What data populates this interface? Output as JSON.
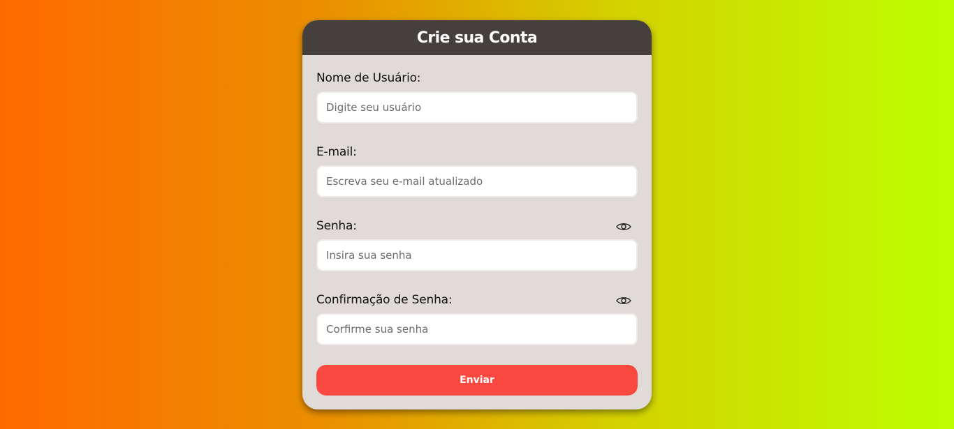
{
  "form": {
    "title": "Crie sua Conta",
    "fields": [
      {
        "label": "Nome de Usuário:",
        "placeholder": "Digite seu usuário",
        "value": ""
      },
      {
        "label": "E-mail:",
        "placeholder": "Escreva seu e-mail atualizado",
        "value": ""
      },
      {
        "label": "Senha:",
        "placeholder": "Insira sua senha",
        "value": "",
        "icon": "eye-icon"
      },
      {
        "label": "Confirmação de Senha:",
        "placeholder": "Corfirme sua senha",
        "value": "",
        "icon": "eye-icon"
      }
    ],
    "submit_label": "Enviar"
  },
  "colors": {
    "background_gradient": [
      "#ff6a00",
      "#bdff00"
    ],
    "header": "#45403d",
    "card": "#e0dbd8",
    "button": "#f84840"
  }
}
